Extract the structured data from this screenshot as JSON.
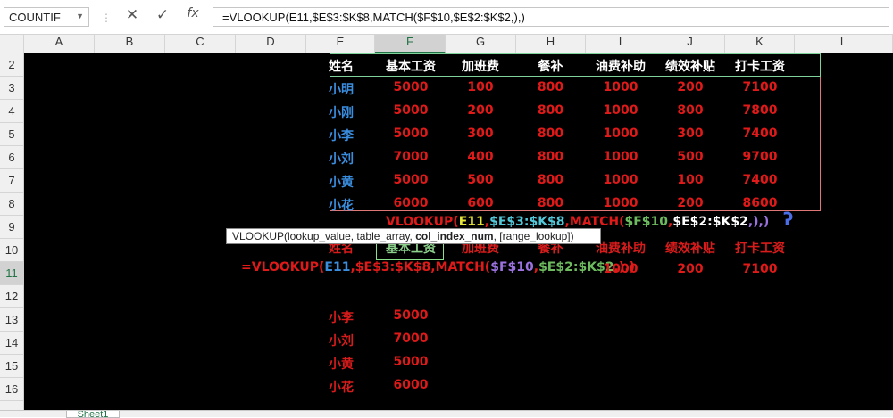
{
  "name_box": "COUNTIF",
  "formula_bar": {
    "cancel_icon": "✕",
    "enter_icon": "✓",
    "fx_label": "fx",
    "value": "=VLOOKUP(E11,$E$3:$K$8,MATCH($F$10,$E$2:$K$2,),)"
  },
  "columns": [
    "A",
    "B",
    "C",
    "D",
    "E",
    "F",
    "G",
    "H",
    "I",
    "J",
    "K",
    "L"
  ],
  "rows": [
    "2",
    "3",
    "4",
    "5",
    "6",
    "7",
    "8",
    "9",
    "10",
    "11",
    "12",
    "13",
    "14",
    "15",
    "16"
  ],
  "table": {
    "headers": [
      "姓名",
      "基本工资",
      "加班费",
      "餐补",
      "油费补助",
      "绩效补贴",
      "打卡工资"
    ],
    "rows": [
      [
        "小明",
        "5000",
        "100",
        "800",
        "1000",
        "200",
        "7100"
      ],
      [
        "小刚",
        "5000",
        "200",
        "800",
        "1000",
        "800",
        "7800"
      ],
      [
        "小李",
        "5000",
        "300",
        "800",
        "1000",
        "300",
        "7400"
      ],
      [
        "小刘",
        "7000",
        "400",
        "800",
        "1000",
        "500",
        "9700"
      ],
      [
        "小黄",
        "5000",
        "500",
        "800",
        "1000",
        "100",
        "7400"
      ],
      [
        "小花",
        "6000",
        "600",
        "800",
        "1000",
        "200",
        "8600"
      ]
    ]
  },
  "row9_formula": {
    "p1": "VLOOKUP(",
    "p2": "E11",
    "p3": ",",
    "p4": "$E$3:$K$8",
    "p5": ",MATCH(",
    "p6": "$F$10",
    "p7": ",",
    "p8": "$E$2:$K$2",
    "p9": ",),)"
  },
  "row10_headers": [
    "姓名",
    "基本工资",
    "加班费",
    "餐补",
    "油费补助",
    "绩效补贴",
    "打卡工资"
  ],
  "row11_formula": {
    "p1": "=VLOOKUP(",
    "p2": "E11",
    "p3": ",",
    "p4": "$E$3:$K$8",
    "p5": ",MATCH(",
    "p6": "$F$10",
    "p7": ",",
    "p8": "$E$2:$K$2",
    "p9": ",),)"
  },
  "row11_values": [
    "1000",
    "200",
    "7100"
  ],
  "tooltip": {
    "func": "VLOOKUP(lookup_value, table_array, ",
    "bold": "col_index_num",
    "rest": ", [range_lookup])"
  },
  "lower_rows": [
    [
      "小李",
      "5000"
    ],
    [
      "小刘",
      "7000"
    ],
    [
      "小黄",
      "5000"
    ],
    [
      "小花",
      "6000"
    ]
  ],
  "sheet_tab": "Sheet1",
  "colors": {
    "grid_bg": "#000000",
    "name_blue": "#3a8ee0",
    "value_red": "#e01919",
    "formula_yellow": "#e8e83a",
    "formula_cyan": "#52c7d8",
    "formula_green": "#6dbb5e",
    "formula_purple": "#9b72e0",
    "excel_green": "#217346"
  }
}
